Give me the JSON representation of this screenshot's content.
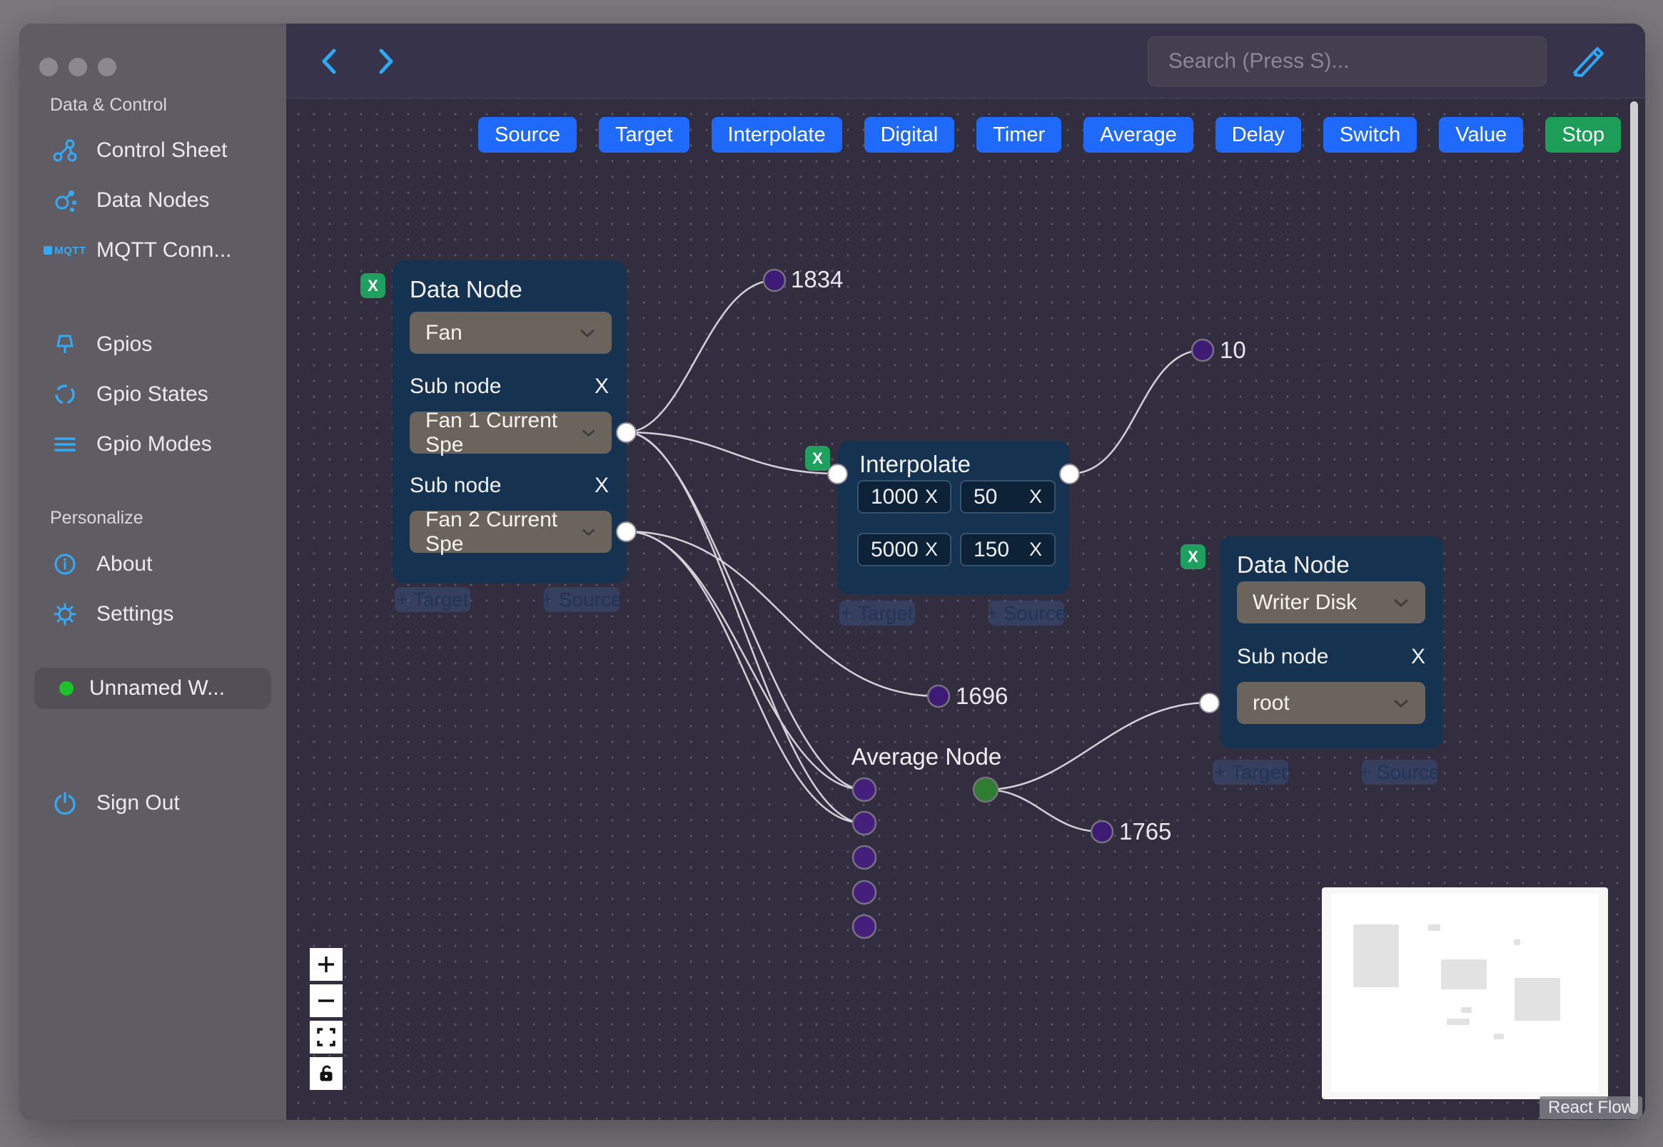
{
  "colors": {
    "accent_blue": "#1f6afa",
    "accent_green": "#1d9e58",
    "icon_blue": "#35aaf4",
    "node_bg": "#153250",
    "canvas_bg": "#322e3f",
    "status_green": "#1bc22a"
  },
  "window": {
    "search_placeholder": "Search (Press S)...",
    "react_flow_label": "React Flow"
  },
  "sidebar": {
    "section_data_control": "Data & Control",
    "control_sheet": "Control Sheet",
    "data_nodes": "Data Nodes",
    "mqtt": "MQTT Conn...",
    "gpios": "Gpios",
    "gpio_states": "Gpio States",
    "gpio_modes": "Gpio Modes",
    "section_personalize": "Personalize",
    "about": "About",
    "settings": "Settings",
    "workspace": "Unnamed W...",
    "sign_out": "Sign Out"
  },
  "toolbar": {
    "buttons": [
      "Source",
      "Target",
      "Interpolate",
      "Digital",
      "Timer",
      "Average",
      "Delay",
      "Switch",
      "Value"
    ],
    "stop": "Stop"
  },
  "ui": {
    "x": "X"
  },
  "pills": {
    "target": "+ Target",
    "source": "+ Source"
  },
  "nodes": {
    "fan": {
      "title": "Data Node",
      "selected": "Fan",
      "sub_label": "Sub node",
      "sub1_selected": "Fan 1 Current Spe",
      "sub2_selected": "Fan 2 Current Spe"
    },
    "interpolate": {
      "title": "Interpolate",
      "in1": "1000",
      "in2": "50",
      "in3": "5000",
      "in4": "150"
    },
    "writer": {
      "title": "Data Node",
      "selected": "Writer Disk",
      "sub_label": "Sub node",
      "sub_selected": "root"
    },
    "average": {
      "title": "Average Node"
    }
  },
  "edge_values": {
    "top": "1834",
    "right": "10",
    "middle": "1696",
    "bottom": "1765"
  }
}
